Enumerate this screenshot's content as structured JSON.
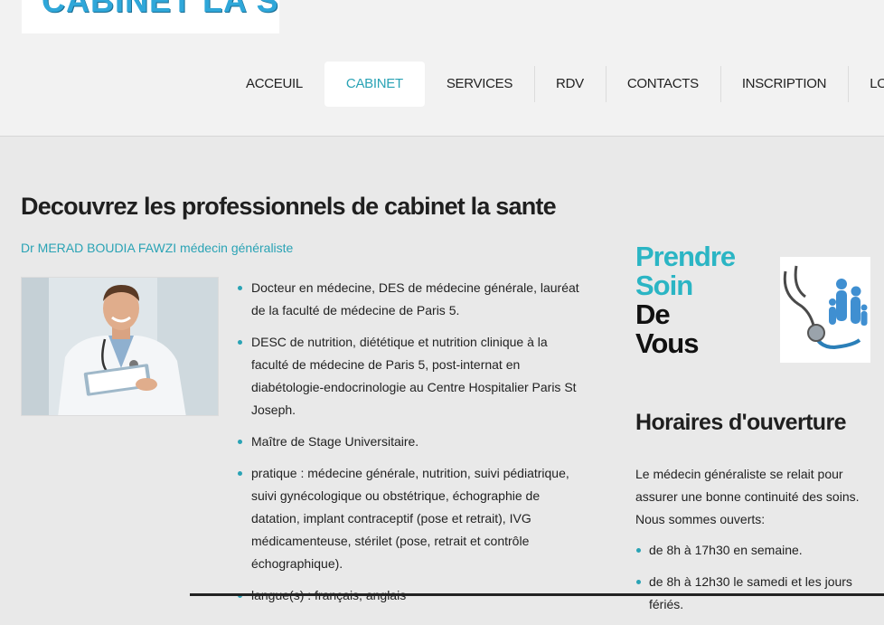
{
  "logo": {
    "text": "CABINET LA SANTE"
  },
  "nav": {
    "items": [
      {
        "label": "ACCEUIL",
        "active": false
      },
      {
        "label": "CABINET",
        "active": true
      },
      {
        "label": "SERVICES",
        "active": false
      },
      {
        "label": "RDV",
        "active": false
      },
      {
        "label": "CONTACTS",
        "active": false
      },
      {
        "label": "INSCRIPTION",
        "active": false
      },
      {
        "label": "LOGIN",
        "active": false
      }
    ]
  },
  "main": {
    "title": "Decouvrez les professionnels de cabinet la sante",
    "subtitle": "Dr MERAD BOUDIA FAWZI médecin généraliste",
    "bio": [
      "Docteur en médecine, DES de médecine générale, lauréat de la faculté de médecine de Paris 5.",
      "DESC de nutrition, diététique et nutrition clinique à la faculté de médecine de Paris 5, post-internat en diabétologie-endocrinologie au Centre Hospitalier Paris St Joseph.",
      "Maître de Stage Universitaire.",
      "pratique : médecine générale, nutrition, suivi pédiatrique, suivi gynécologique ou obstétrique, échographie de datation, implant contraceptif (pose et retrait), IVG médicamenteuse, stérilet (pose, retrait et contrôle échographique).",
      "langue(s) : français, anglais"
    ]
  },
  "sidebar": {
    "soin_line1": "Prendre",
    "soin_line2": "Soin",
    "soin_line3": "De",
    "soin_line4": "Vous",
    "hours_title": "Horaires d'ouverture",
    "hours_intro": "Le médecin généraliste se relait pour assurer une bonne continuité des soins. Nous sommes ouverts:",
    "hours": [
      "de 8h à 17h30 en semaine.",
      "de 8h à 12h30 le samedi et les jours fériés."
    ]
  },
  "colors": {
    "accent": "#2aa3b5",
    "logo": "#2fa7d9",
    "background": "#e9e9e9"
  }
}
